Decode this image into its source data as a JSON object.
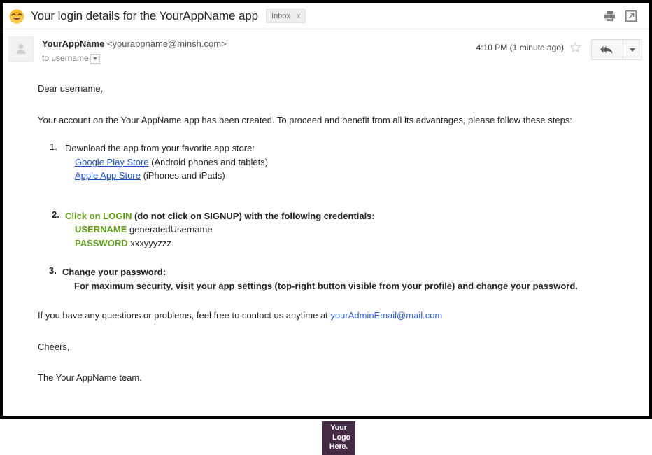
{
  "header": {
    "emoji": "grinning-smiling-eyes-emoji",
    "subject": "Your login details for the YourAppName app",
    "label_chip": "Inbox",
    "label_chip_close": "x",
    "print_icon": "print-icon",
    "popout_icon": "open-in-new-window-icon"
  },
  "sender": {
    "avatar_icon": "default-avatar-icon",
    "name": "YourAppName",
    "email": "<yourappname@minsh.com>",
    "recipient": "to username",
    "recipient_caret": "chevron-down-icon",
    "timestamp": "4:10 PM (1 minute ago)",
    "star_icon": "star-outline-icon",
    "reply_icon": "reply-all-icon",
    "more_caret": "chevron-down-icon"
  },
  "body": {
    "greeting": "Dear username,",
    "intro": "Your account on the Your AppName app has been created. To proceed and benefit from all its advantages, please follow these steps:",
    "step1": {
      "number": "1.",
      "heading": "Download the app from your favorite app store:",
      "link_google": "Google Play Store",
      "google_suffix": " (Android phones and tablets)",
      "link_apple": "Apple App Store",
      "apple_suffix": " (iPhones and iPads)"
    },
    "step2": {
      "number": "2.",
      "heading_green": "Click on LOGIN",
      "heading_rest": " (do not click on SIGNUP) with the following credentials:",
      "username_label": "USERNAME",
      "username_value": "generatedUsername",
      "password_label": "PASSWORD",
      "password_value": "xxxyyyzzz"
    },
    "step3": {
      "number": "3.",
      "heading": "Change your password:",
      "detail": "For maximum security, visit your app settings (top-right button visible from your profile) and change your password."
    },
    "contact_prefix": "If you have any questions or problems, feel free to contact us anytime at ",
    "contact_email": "yourAdminEmail@mail.com",
    "signoff": "Cheers,",
    "team_line": "The Your AppName team."
  },
  "footer": {
    "logo_line1": "Your",
    "logo_line2": "Logo",
    "logo_line3": "Here.",
    "logo_color": "#452c44"
  },
  "colors": {
    "green_accent": "#5f9c1a",
    "link_blue": "#1a4fc4",
    "email_blue": "#2a62d6",
    "frame_border": "#000000"
  }
}
